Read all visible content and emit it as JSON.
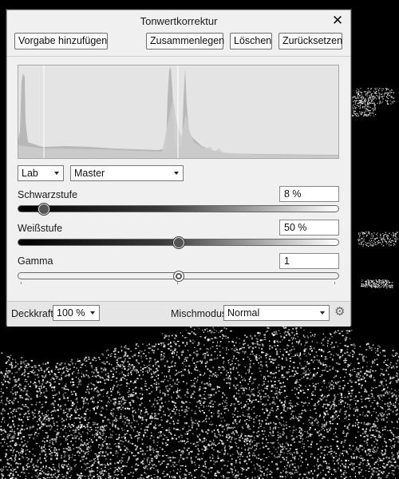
{
  "dialog": {
    "title": "Tonwertkorrektur",
    "close_label": "✕",
    "buttons": {
      "add_preset": "Vorgabe hinzufügen",
      "merge": "Zusammenlegen",
      "delete": "Löschen",
      "reset": "Zurücksetzen"
    },
    "histogram": {
      "black_marker_pct": 8,
      "white_marker_pct": 50
    },
    "color_space": "Lab",
    "channel": "Master",
    "black_level": {
      "label": "Schwarzstufe",
      "value": "8 %",
      "fraction": 0.08
    },
    "white_level": {
      "label": "Weißstufe",
      "value": "50 %",
      "fraction": 0.5
    },
    "gamma": {
      "label": "Gamma",
      "value": "1",
      "fraction": 0.5
    },
    "footer": {
      "opacity_label": "Deckkraft:",
      "opacity_value": "100 %",
      "blend_label": "Mischmodus:",
      "blend_value": "Normal",
      "settings_icon": "gear-icon"
    }
  }
}
